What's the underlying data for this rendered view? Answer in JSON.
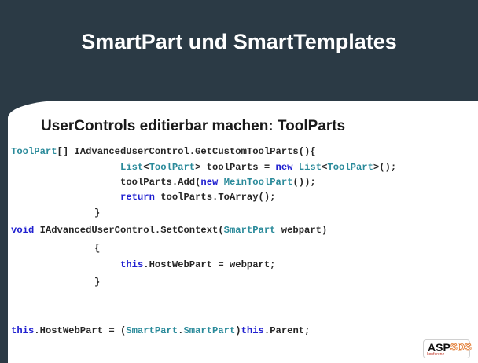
{
  "slide": {
    "title": "SmartPart und SmartTemplates",
    "subtitle": "UserControls editierbar machen: ToolParts"
  },
  "code": {
    "l1": {
      "t1": "ToolPart",
      "t2": "[] ",
      "t3": "IAdvancedUserControl",
      "t4": ".GetCustomToolParts(){"
    },
    "l2": {
      "t1": "List",
      "t2": "<",
      "t3": "ToolPart",
      "t4": "> toolParts = ",
      "t5": "new",
      "t6": " ",
      "t7": "List",
      "t8": "<",
      "t9": "ToolPart",
      "t10": ">();"
    },
    "l3": {
      "t1": "toolParts.Add(",
      "t2": "new",
      "t3": " ",
      "t4": "MeinToolPart",
      "t5": "());"
    },
    "l4": {
      "t1": "return",
      "t2": " toolParts.ToArray();"
    },
    "l5": "}",
    "l6": {
      "t1": "void",
      "t2": " ",
      "t3": "IAdvancedUserControl",
      "t4": ".SetContext(",
      "t5": "SmartPart",
      "t6": " webpart)"
    },
    "l7": "{",
    "l8": {
      "t1": "this",
      "t2": ".HostWebPart = webpart;"
    },
    "l9": "}",
    "l10": {
      "t1": "this",
      "t2": ".HostWebPart = (",
      "t3": "SmartPart",
      "t4": ".",
      "t5": "SmartPart",
      "t6": ")",
      "t7": "this",
      "t8": ".Parent;"
    }
  },
  "logo": {
    "asp": "ASP",
    "sds": "SDS",
    "sub": "konferenz"
  },
  "colors": {
    "background": "#2b3a45",
    "keyword": "#1f1fd0",
    "type": "#2a8a9a"
  }
}
